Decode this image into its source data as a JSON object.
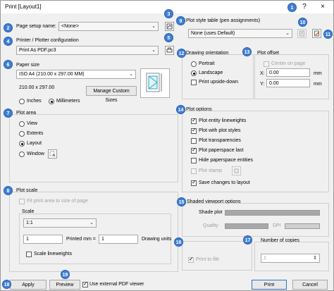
{
  "window": {
    "title": "Print [Layout1]",
    "help_label": "?",
    "close_label": "×"
  },
  "page_setup": {
    "label": "Page setup name:",
    "value": "<None>"
  },
  "printer": {
    "section_label": "Printer / Plotter configuration",
    "value": "Print As PDF.pc3"
  },
  "paper": {
    "section_label": "Paper size",
    "value": "ISO A4 (210.00 x 297.00 MM)",
    "dims": "210.00 x 297.00",
    "units": [
      "Inches",
      "Millimeters"
    ],
    "selected_unit": "Millimeters",
    "manage_button": "Manage Custom Sizes"
  },
  "plot_area": {
    "section_label": "Plot area",
    "options": [
      "View",
      "Extents",
      "Layout",
      "Window"
    ],
    "selected": "Layout"
  },
  "plot_scale": {
    "section_label": "Plot scale",
    "fit_label": "Fit print area to size of page",
    "scale_label": "Scale",
    "scale_value": "1:1",
    "printed_value": "1",
    "printed_label": "Printed mm =",
    "drawing_value": "1",
    "drawing_label": "Drawing units",
    "lineweights_label": "Scale lineweights"
  },
  "style_table": {
    "section_label": "Plot style table (pen assignments)",
    "value": "None (uses Default)"
  },
  "orientation": {
    "section_label": "Drawing orientation",
    "options": [
      "Portrait",
      "Landscape"
    ],
    "selected": "Landscape",
    "upside_down_label": "Print upside-down"
  },
  "offset": {
    "section_label": "Plot offset",
    "center_label": "Center on page",
    "x_label": "X:",
    "x_value": "0.00",
    "y_label": "Y:",
    "y_value": "0.00",
    "unit": "mm"
  },
  "plot_options": {
    "section_label": "Plot options",
    "items": [
      {
        "label": "Plot entity lineweights",
        "checked": true,
        "disabled": false
      },
      {
        "label": "Plot with plot styles",
        "checked": true,
        "disabled": false
      },
      {
        "label": "Plot transparencies",
        "checked": false,
        "disabled": false
      },
      {
        "label": "Plot paperspace last",
        "checked": true,
        "disabled": false
      },
      {
        "label": "Hide paperspace entities",
        "checked": false,
        "disabled": false
      },
      {
        "label": "Plot stamp",
        "checked": false,
        "disabled": true
      },
      {
        "label": "Save changes to layout",
        "checked": true,
        "disabled": false
      }
    ]
  },
  "shaded": {
    "section_label": "Shaded viewport options",
    "shade_label": "Shade plot",
    "quality_label": "Quality",
    "dpi_label": "DPI"
  },
  "print_to_file": {
    "label": "Print to file"
  },
  "copies": {
    "section_label": "Number of copies",
    "value": "1"
  },
  "footer": {
    "apply": "Apply",
    "preview": "Preview",
    "external_pdf_label": "Use external PDF viewer",
    "print": "Print",
    "cancel": "Cancel"
  },
  "callouts": [
    "1",
    "2",
    "3",
    "4",
    "5",
    "6",
    "7",
    "8",
    "9",
    "10",
    "11",
    "12",
    "13",
    "14",
    "15",
    "16",
    "17",
    "18",
    "19"
  ],
  "colors": {
    "accent": "#3f7ed6",
    "background": "#f0f0f0",
    "primary_border": "#2b73c8"
  }
}
